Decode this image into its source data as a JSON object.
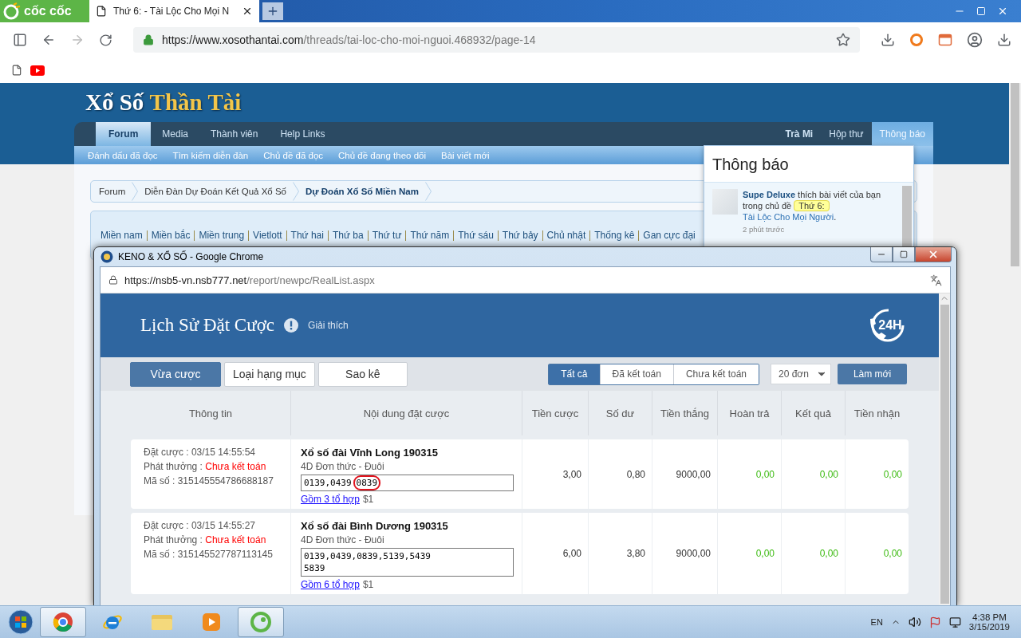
{
  "browser": {
    "brand": "cốc cốc",
    "tabs": [
      {
        "title": "Thứ 6: - Tài Lộc Cho Mọi N",
        "selected": true
      }
    ],
    "url": {
      "origin": "https://www.xosothantai.com",
      "path": "/threads/tai-loc-cho-moi-nguoi.468932/page-14"
    }
  },
  "forum": {
    "logo": {
      "first": "Xổ Số",
      "second": "Thần Tài"
    },
    "nav": [
      {
        "label": "Forum",
        "selected": true
      },
      {
        "label": "Media",
        "selected": false
      },
      {
        "label": "Thành viên",
        "selected": false
      },
      {
        "label": "Help Links",
        "selected": false
      }
    ],
    "account": [
      {
        "label": "Trà Mi",
        "selected": false
      },
      {
        "label": "Hộp thư",
        "selected": false
      },
      {
        "label": "Thông báo",
        "selected": true
      }
    ],
    "subnav": [
      "Đánh dấu đã đọc",
      "Tìm kiếm diễn đàn",
      "Chủ đề đã đọc",
      "Chủ đề đang theo dõi",
      "Bài viết mới"
    ],
    "breadcrumb": [
      {
        "label": "Forum",
        "current": false
      },
      {
        "label": "Diễn Đàn Dự Đoán Kết Quả Xổ Số",
        "current": false
      },
      {
        "label": "Dự Đoán Xổ Số Miền Nam",
        "current": true
      }
    ],
    "quick_links": [
      "Miền nam",
      "Miền bắc",
      "Miền trung",
      "Vietlott",
      "Thứ hai",
      "Thứ ba",
      "Thứ tư",
      "Thứ năm",
      "Thứ sáu",
      "Thứ bảy",
      "Chủ nhật",
      "Thống kê",
      "Gan cực đại"
    ]
  },
  "notifications": {
    "title": "Thông báo",
    "items": [
      {
        "user": "Supe Deluxe",
        "action": "thích bài viết của bạn trong chủ đề",
        "prefix": "Thứ 6:",
        "thread": "Tài Lộc Cho Mọi Người",
        "suffix": ".",
        "time": "2 phút trước"
      }
    ]
  },
  "popup": {
    "title": "KENO & XỔ SỐ - Google Chrome",
    "url": {
      "origin": "https://nsb5-vn.nsb777.net",
      "path": "/report/newpc/RealList.aspx"
    },
    "heading": "Lịch Sử Đặt Cược",
    "help": "Giải thích",
    "support_badge": "24H",
    "tabs": [
      {
        "label": "Vừa cược",
        "selected": true
      },
      {
        "label": "Loại hạng mục",
        "selected": false
      },
      {
        "label": "Sao kê",
        "selected": false
      }
    ],
    "filters": [
      {
        "label": "Tất cả",
        "selected": true
      },
      {
        "label": "Đã kết toán",
        "selected": false
      },
      {
        "label": "Chưa kết toán",
        "selected": false
      }
    ],
    "page_size": "20 đơn",
    "refresh": "Làm mới",
    "columns": [
      "Thông tin",
      "Nội dung đặt cược",
      "Tiền cược",
      "Số dư",
      "Tiền thắng",
      "Hoàn trả",
      "Kết quả",
      "Tiền nhận"
    ],
    "rows": [
      {
        "placed": "Đặt cược : 03/15 14:55:54",
        "payout_label": "Phát thưởng : ",
        "payout_status": "Chưa kết toán",
        "code": "Mã số : 315145554786688187",
        "game": "Xổ số đài Vĩnh Long 190315",
        "bet_type": "4D Đơn thức - Đuôi",
        "numbers": [
          "0139,0439"
        ],
        "circled": "0839",
        "combos": "Gồm 3 tổ hợp",
        "unit": "$1",
        "amounts": [
          {
            "text": "3,00",
            "color": "#333333"
          },
          {
            "text": "0,80",
            "color": "#333333"
          },
          {
            "text": "9000,00",
            "color": "#333333"
          },
          {
            "text": "0,00",
            "color": "#3dbb12"
          },
          {
            "text": "0,00",
            "color": "#3dbb12"
          },
          {
            "text": "0,00",
            "color": "#3dbb12"
          }
        ]
      },
      {
        "placed": "Đặt cược : 03/15 14:55:27",
        "payout_label": "Phát thưởng : ",
        "payout_status": "Chưa kết toán",
        "code": "Mã số : 315145527787113145",
        "game": "Xổ số đài Bình Dương 190315",
        "bet_type": "4D Đơn thức - Đuôi",
        "numbers": [
          "0139,0439,0839,5139,5439",
          "5839"
        ],
        "combos": "Gồm 6 tổ hợp",
        "unit": "$1",
        "amounts": [
          {
            "text": "6,00",
            "color": "#333333"
          },
          {
            "text": "3,80",
            "color": "#333333"
          },
          {
            "text": "9000,00",
            "color": "#333333"
          },
          {
            "text": "0,00",
            "color": "#3dbb12"
          },
          {
            "text": "0,00",
            "color": "#3dbb12"
          },
          {
            "text": "0,00",
            "color": "#3dbb12"
          }
        ]
      }
    ]
  },
  "taskbar": {
    "apps": [
      {
        "kind": "chrome",
        "selected": true
      },
      {
        "kind": "ie",
        "selected": false
      },
      {
        "kind": "folder",
        "selected": false
      },
      {
        "kind": "media",
        "selected": false
      },
      {
        "kind": "coccoc",
        "selected": true
      }
    ],
    "language": "EN",
    "time": "4:38 PM",
    "date": "3/15/2019"
  }
}
